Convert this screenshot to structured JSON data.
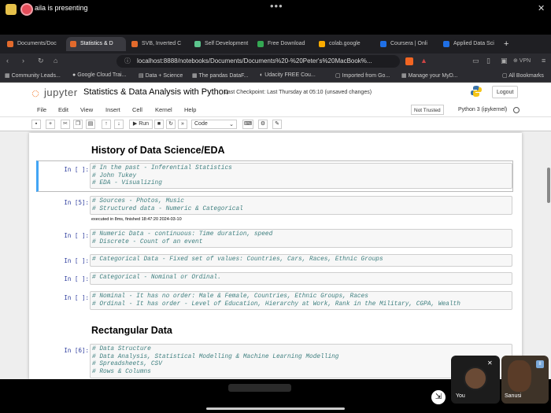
{
  "presenter": {
    "text": "aila is presenting"
  },
  "tabs": [
    {
      "label": "Documents/Doc",
      "color": "#e26a2c"
    },
    {
      "label": "Statistics & D",
      "color": "#e26a2c"
    },
    {
      "label": "SVB, Inverted C",
      "color": "#e26a2c"
    },
    {
      "label": "Self Development",
      "color": "#5bc48c"
    },
    {
      "label": "Free Download",
      "color": "#34a853"
    },
    {
      "label": "colab.google",
      "color": "#f9ab00"
    },
    {
      "label": "Coursera | Onli",
      "color": "#1f6fe5"
    },
    {
      "label": "Applied Data Sci",
      "color": "#1f6fe5"
    }
  ],
  "address": {
    "url": "localhost:8888/notebooks/Documents/Documents%20-%20Peter's%20MacBook%..."
  },
  "bookmarks": [
    "Community Leads...",
    "Google Cloud Trai...",
    "Data + Science",
    "The pandas DataF...",
    "Udacity FREE Cou...",
    "Imported from Go...",
    "Manage your MyD...",
    "All Bookmarks"
  ],
  "jupyter": {
    "logo_word": "jupyter",
    "title": "Statistics & Data Analysis with Python",
    "checkpoint": "Last Checkpoint: Last Thursday at 05:10  (unsaved changes)",
    "logout": "Logout",
    "menu": [
      "File",
      "Edit",
      "View",
      "Insert",
      "Cell",
      "Kernel",
      "Help"
    ],
    "trust": "Not Trusted",
    "kernel": "Python 3 (ipykernel)",
    "run_label": "Run",
    "cell_type": "Code"
  },
  "notebook": {
    "heading1": "History of Data Science/EDA",
    "heading2": "Rectangular Data",
    "cells": [
      {
        "prompt": "In [ ]:",
        "lines": [
          "# In the past - Inferential Statistics",
          "# John Tukey",
          "# EDA - Visualizing"
        ]
      },
      {
        "prompt": "In [5]:",
        "lines": [
          "# Sources - Photos, Music",
          "# Structured data - Numeric & Categorical"
        ],
        "output": "executed in 8ms, finished 18:47:20 2024-03-10"
      },
      {
        "prompt": "In [ ]:",
        "lines": [
          "# Numeric Data - continuous: Time duration, speed",
          "# Discrete - Count of an event"
        ]
      },
      {
        "prompt": "In [ ]:",
        "lines": [
          "# Categorical Data - Fixed set of values: Countries, Cars, Races, Ethnic Groups"
        ]
      },
      {
        "prompt": "In [ ]:",
        "lines": [
          "# Categorical - Nominal or Ordinal."
        ]
      },
      {
        "prompt": "In [ ]:",
        "lines": [
          "# Nominal - It has no order: Male & Female, Countries, Ethnic Groups, Races",
          "# Ordinal - It has order - Level of Education, Hierarchy at Work, Rank in the Military, CGPA, Wealth"
        ]
      },
      {
        "prompt": "In [6]:",
        "lines": [
          "# Data Structure",
          "# Data Analysis, Statistical Modelling & Machine Learning Modelling",
          "# Spreadsheets, CSV",
          "# Rows & Columns"
        ]
      }
    ]
  },
  "participants": [
    {
      "name": "You"
    },
    {
      "name": "Sanusi"
    }
  ]
}
